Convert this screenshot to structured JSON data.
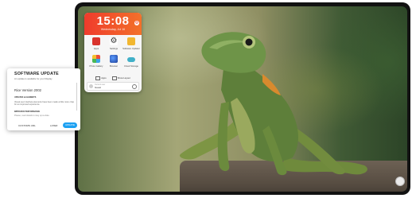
{
  "launcher": {
    "time": "15:08",
    "date": "Wednesday, Jul 16",
    "apps": [
      {
        "label": "Apps",
        "icon": "apps-icon"
      },
      {
        "label": "Settings",
        "icon": "gear-icon"
      },
      {
        "label": "Software Updater",
        "icon": "software-updater-icon"
      },
      {
        "label": "Photo Gallery",
        "icon": "photo-gallery-icon"
      },
      {
        "label": "Browser",
        "icon": "browser-icon"
      },
      {
        "label": "Cloud Storage",
        "icon": "cloud-icon"
      }
    ],
    "buttons": [
      "Apps",
      "Show Layout"
    ],
    "user": {
      "caption": "Current user",
      "name": "Guest"
    }
  },
  "update": {
    "title": "SOFTWARE UPDATE",
    "subtitle": "An update is available for your Display",
    "version": "Rice Version 2002",
    "section1": "UPDATES & ELEMENTS",
    "paragraph1": "Visual user interface elements have been made a little more crisp for an improved experience.",
    "section2": "IMPROVED PERFORMANCE",
    "paragraph2": "Please, read details to stay up-to-date.",
    "custom_label": "CUSTOMS URL",
    "later_label": "LATER",
    "update_label": "UPDATE"
  },
  "colors": {
    "accent": "#1da1f2",
    "clock_header": "#ef3b2c"
  }
}
